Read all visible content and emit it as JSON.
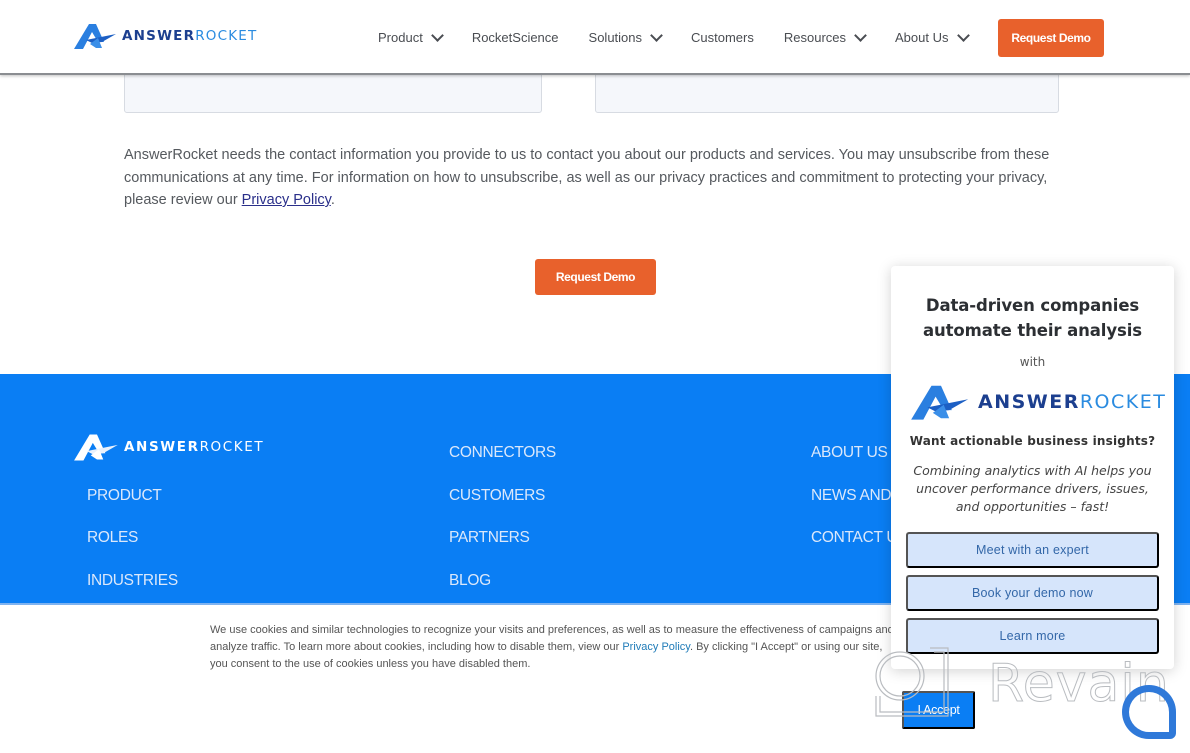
{
  "header": {
    "brand": {
      "part1": "ANSWER",
      "part2": "ROCKET"
    },
    "nav": [
      {
        "label": "Product",
        "has_dropdown": true
      },
      {
        "label": "RocketScience",
        "has_dropdown": false
      },
      {
        "label": "Solutions",
        "has_dropdown": true
      },
      {
        "label": "Customers",
        "has_dropdown": false
      },
      {
        "label": "Resources",
        "has_dropdown": true
      },
      {
        "label": "About Us",
        "has_dropdown": true
      }
    ],
    "cta_label": "Request Demo"
  },
  "form": {
    "field_left_value": "",
    "field_right_value": "",
    "consent_text": "AnswerRocket needs the contact information you provide to us to contact you about our products and services. You may unsubscribe from these communications at any time. For information on how to unsubscribe, as well as our privacy practices and commitment to protecting your privacy, please review our ",
    "privacy_link": "Privacy Policy",
    "consent_end": ".",
    "submit_label": "Request Demo"
  },
  "footer": {
    "brand": {
      "part1": "ANSWER",
      "part2": "ROCKET"
    },
    "col1": [
      "PRODUCT",
      "ROLES",
      "INDUSTRIES"
    ],
    "col2": [
      "CONNECTORS",
      "CUSTOMERS",
      "PARTNERS",
      "BLOG"
    ],
    "col3": [
      "ABOUT US",
      "NEWS AND",
      "CONTACT U"
    ]
  },
  "cookie": {
    "text1": "We use cookies and similar technologies to recognize your visits and preferences, as well as to measure the effectiveness of campaigns and analyze traffic. To learn more about cookies, including how to disable them, view our ",
    "link": "Privacy Policy",
    "text2": ". By clicking \"I Accept\" or using our site, you consent to the use of cookies unless you have disabled them.",
    "accept_label": "I Accept"
  },
  "popup": {
    "headline": "Data-driven companies automate their analysis",
    "with": "with",
    "brand": {
      "part1": "ANSWER",
      "part2": "ROCKET"
    },
    "question": "Want actionable business insights?",
    "description": "Combining analytics with AI helps you uncover performance drivers, issues, and opportunities – fast!",
    "buttons": [
      "Meet with an expert",
      "Book your demo now",
      "Learn more"
    ]
  },
  "watermark": {
    "text": "Revain"
  },
  "colors": {
    "brand_blue": "#0a7ef4",
    "accent_orange": "#e8612c",
    "navy": "#1c3f8f"
  }
}
